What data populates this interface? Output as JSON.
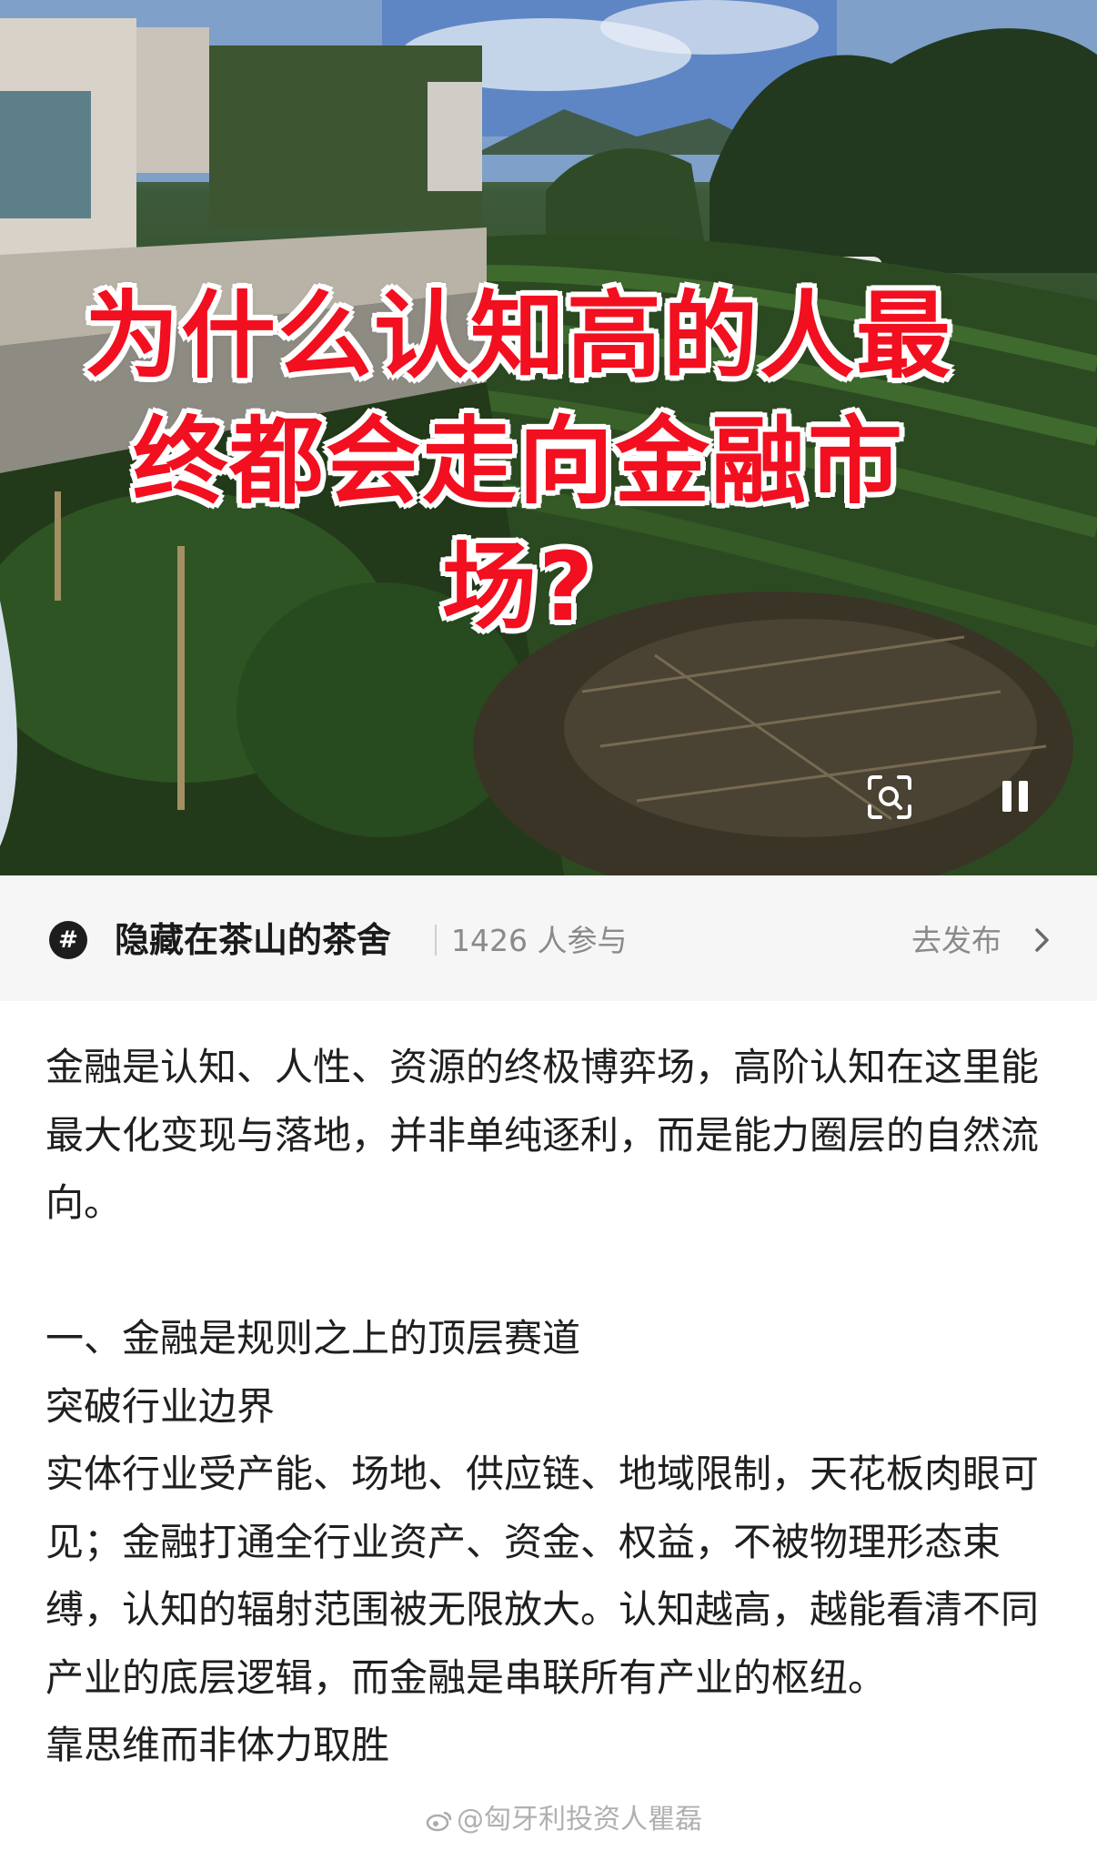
{
  "video": {
    "title_line1": "为什么认知高的人最",
    "title_line2": "终都会走向金融市",
    "title_line3": "场?",
    "scan_icon": "scan-search-icon",
    "pause_icon": "pause-icon"
  },
  "topic": {
    "icon": "hashtag-icon",
    "hash_symbol": "#",
    "name": "隐藏在茶山的茶舍",
    "count": "1426 人参与",
    "action_label": "去发布",
    "action_icon": "chevron-right-icon"
  },
  "article": {
    "paragraphs": [
      "金融是认知、人性、资源的终极博弈场，高阶认知在这里能最大化变现与落地，并非单纯逐利，而是能力圈层的自然流向。",
      "",
      "一、金融是规则之上的顶层赛道",
      "突破行业边界",
      "实体行业受产能、场地、供应链、地域限制，天花板肉眼可见；金融打通全行业资产、资金、权益，不被物理形态束缚，认知的辐射范围被无限放大。认知越高，越能看清不同产业的底层逻辑，而金融是串联所有产业的枢纽。",
      "靠思维而非体力取胜"
    ]
  },
  "watermark": {
    "icon": "weibo-icon",
    "text": "@匈牙利投资人瞿磊"
  }
}
